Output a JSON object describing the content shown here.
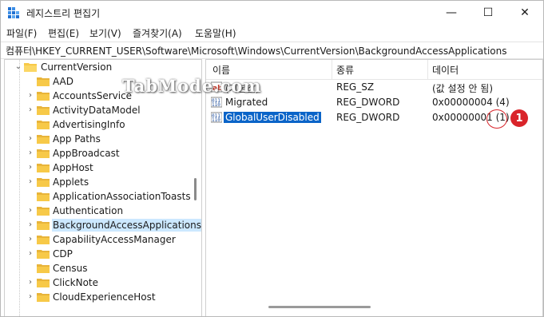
{
  "window": {
    "title": "레지스트리 편집기",
    "minimize_label": "—",
    "maximize_label": "☐",
    "close_label": "✕"
  },
  "menu": [
    "파일(F)",
    "편집(E)",
    "보기(V)",
    "즐겨찾기(A)",
    "도움말(H)"
  ],
  "address": "컴퓨터\\HKEY_CURRENT_USER\\Software\\Microsoft\\Windows\\CurrentVersion\\BackgroundAccessApplications",
  "tree": {
    "parent": "CurrentVersion",
    "items": [
      {
        "label": "AAD",
        "chevron": false
      },
      {
        "label": "AccountsService",
        "chevron": true
      },
      {
        "label": "ActivityDataModel",
        "chevron": true
      },
      {
        "label": "AdvertisingInfo",
        "chevron": false
      },
      {
        "label": "App Paths",
        "chevron": true
      },
      {
        "label": "AppBroadcast",
        "chevron": true
      },
      {
        "label": "AppHost",
        "chevron": true
      },
      {
        "label": "Applets",
        "chevron": true
      },
      {
        "label": "ApplicationAssociationToasts",
        "chevron": false
      },
      {
        "label": "Authentication",
        "chevron": true
      },
      {
        "label": "BackgroundAccessApplications",
        "chevron": true,
        "selected": true
      },
      {
        "label": "CapabilityAccessManager",
        "chevron": true
      },
      {
        "label": "CDP",
        "chevron": true
      },
      {
        "label": "Census",
        "chevron": false
      },
      {
        "label": "ClickNote",
        "chevron": true
      },
      {
        "label": "CloudExperienceHost",
        "chevron": true
      }
    ]
  },
  "list": {
    "columns": [
      "이름",
      "종류",
      "데이터"
    ],
    "rows": [
      {
        "name": "(기본값)",
        "type": "REG_SZ",
        "data": "(값 설정 안 됨)",
        "icon": "string-value-icon"
      },
      {
        "name": "Migrated",
        "type": "REG_DWORD",
        "data": "0x00000004 (4)",
        "icon": "dword-value-icon"
      },
      {
        "name": "GlobalUserDisabled",
        "type": "REG_DWORD",
        "data": "0x00000001 (1)",
        "icon": "dword-value-icon",
        "selected": true
      }
    ]
  },
  "annotation": {
    "badge": "1",
    "color": "#d9242a"
  },
  "watermark": "TabMode.com",
  "colors": {
    "selection": "#0a64c8",
    "tree_selection": "#cce8ff",
    "folder": "#f7c948"
  }
}
